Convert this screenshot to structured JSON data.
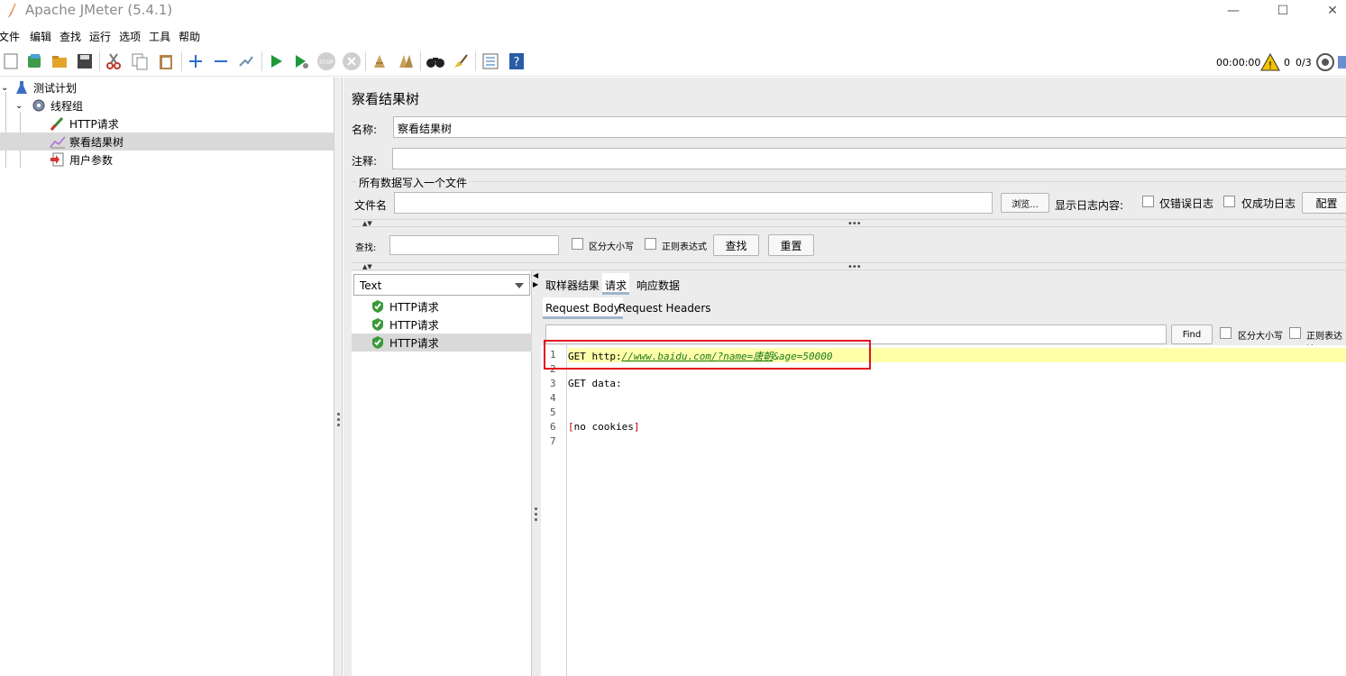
{
  "window": {
    "title": "Apache JMeter (5.4.1)"
  },
  "menu": [
    "文件",
    "编辑",
    "查找",
    "运行",
    "选项",
    "工具",
    "帮助"
  ],
  "toolbar": {
    "timer": "00:00:00",
    "warnings": "0",
    "threads": "0/3",
    "icons": [
      "new-icon",
      "templates-icon",
      "open-icon",
      "save-icon",
      "cut-icon",
      "copy-icon",
      "paste-icon",
      "expand-icon",
      "collapse-icon",
      "toggle-icon",
      "start-icon",
      "start-no-pause-icon",
      "stop-icon",
      "shutdown-icon",
      "clear-icon",
      "clear-all-icon",
      "search-icon",
      "reset-search-icon",
      "function-helper-icon",
      "help-icon"
    ]
  },
  "tree": {
    "items": [
      {
        "label": "测试计划",
        "icon": "flask-icon"
      },
      {
        "label": "线程组",
        "icon": "gear-icon"
      },
      {
        "label": "HTTP请求",
        "icon": "pipette-icon"
      },
      {
        "label": "察看结果树",
        "icon": "graph-icon"
      },
      {
        "label": "用户参数",
        "icon": "param-icon"
      }
    ]
  },
  "panel": {
    "heading": "察看结果树",
    "name_label": "名称:",
    "name_value": "察看结果树",
    "comment_label": "注释:",
    "comment_value": "",
    "group_title": "所有数据写入一个文件",
    "file_label": "文件名",
    "file_value": "",
    "browse_label": "浏览...",
    "log_label": "显示日志内容:",
    "errors_only": "仅错误日志",
    "success_only": "仅成功日志",
    "configure": "配置"
  },
  "search": {
    "label": "查找:",
    "value": "",
    "case_sensitive": "区分大小写",
    "regex": "正则表达式",
    "find_button": "查找",
    "reset_button": "重置"
  },
  "results": {
    "renderer": "Text",
    "samples": [
      "HTTP请求",
      "HTTP请求",
      "HTTP请求"
    ]
  },
  "detail": {
    "tabs": [
      "取样器结果",
      "请求",
      "响应数据"
    ],
    "active_tab": "请求",
    "subtabs": [
      "Request Body",
      "Request Headers"
    ],
    "find_value": "",
    "find_button": "Find",
    "case_sensitive": "区分大小写",
    "regex": "正则表达达"
  },
  "editor": {
    "line_numbers": [
      "1",
      "2",
      "3",
      "4",
      "5",
      "6",
      "7"
    ],
    "line1_prefix": "GET http:",
    "line1_link": "//www.baidu.com/?name=",
    "line1_param": "唐朝",
    "line1_rest": "&age=50000",
    "line3": "GET data:",
    "line6_open": "[",
    "line6_text": "no cookies",
    "line6_close": "]"
  },
  "colors": {
    "highlight": "#ffffaa",
    "annotation_box": "#e0141e",
    "link": "#1a7a1a",
    "bracket": "#c00000"
  }
}
